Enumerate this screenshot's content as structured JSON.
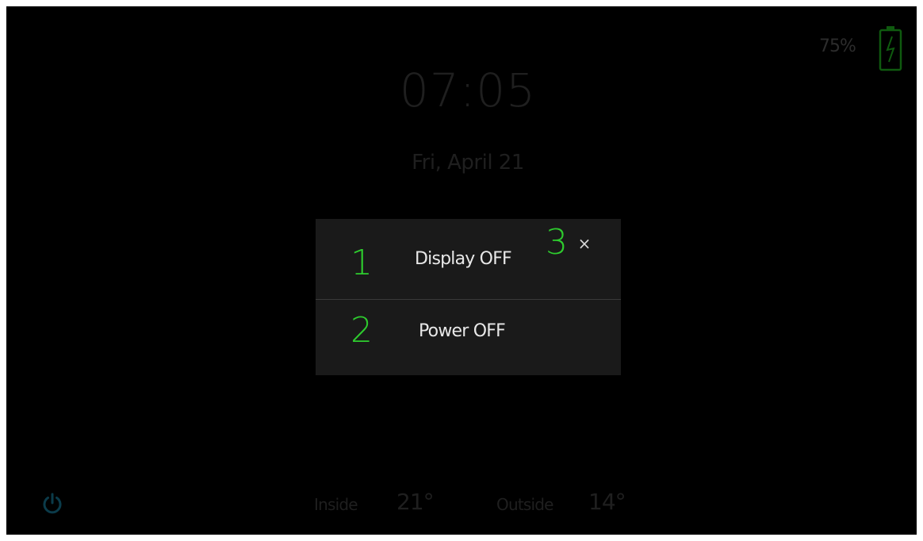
{
  "status": {
    "battery_percent": "75%"
  },
  "clock": {
    "time": "07:05",
    "date": "Fri, April 21"
  },
  "dialog": {
    "items": [
      {
        "label": "Display OFF",
        "callout": "1"
      },
      {
        "label": "Power OFF",
        "callout": "2"
      }
    ],
    "close_callout": "3",
    "close_symbol": "×"
  },
  "climate": {
    "inside_label": "Inside",
    "inside_value": "21°",
    "outside_label": "Outside",
    "outside_value": "14°"
  },
  "icons": {
    "battery": "battery-charging-icon",
    "power": "power-icon",
    "close": "close-icon"
  },
  "colors": {
    "callout_green": "#2ecc2e",
    "battery_green": "#0f5a0f",
    "power_teal": "#0b3b4a",
    "dim_text": "#1f1f1f"
  }
}
